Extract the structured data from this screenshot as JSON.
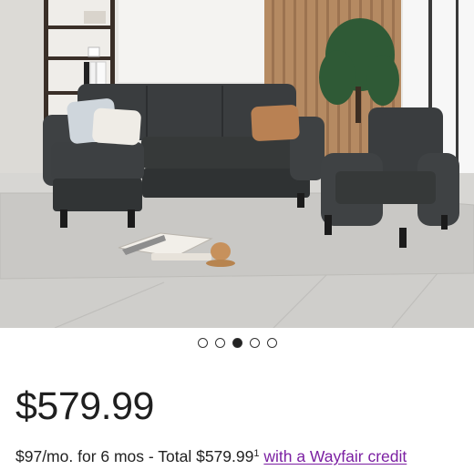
{
  "product": {
    "image_icon": "product-photo-sectional-sofa-and-armchair",
    "carousel": {
      "dots": [
        {
          "active": false
        },
        {
          "active": false
        },
        {
          "active": true
        },
        {
          "active": false
        },
        {
          "active": false
        }
      ]
    },
    "price": "$579.99",
    "financing": {
      "text": "$97/mo. for 6 mos - Total $579.99",
      "footnote": "1",
      "link_text": "with a Wayfair credit"
    }
  },
  "colors": {
    "link": "#7b1fa2",
    "price_text": "#1f1f1f",
    "sofa": "#3a3d3f"
  }
}
